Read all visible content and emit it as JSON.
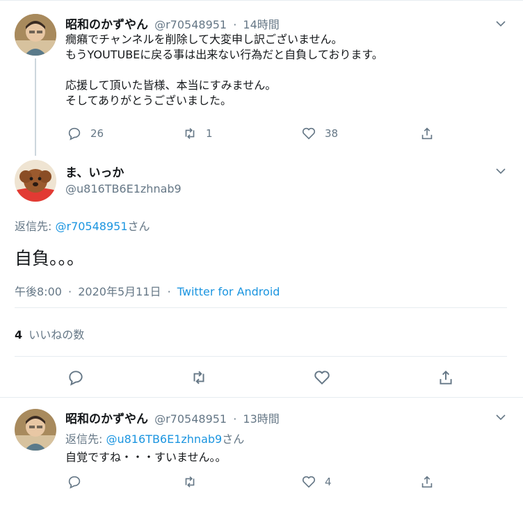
{
  "tweet1": {
    "name": "昭和のかずやん",
    "handle": "@r70548951",
    "sep": "·",
    "time": "14時間",
    "text": "癇癪でチャンネルを削除して大変申し訳ございません。\nもうYOUTUBEに戻る事は出来ない行為だと自負しております。\n\n応援して頂いた皆様、本当にすみません。\nそしてありがとうございました。",
    "replies": "26",
    "retweets": "1",
    "likes": "38"
  },
  "tweet2": {
    "name": "ま、いっか",
    "handle": "@u816TB6E1zhnab9",
    "reply_to_prefix": "返信先: ",
    "reply_to_handle": "@r70548951",
    "reply_to_suffix": "さん",
    "text": "自負。。。",
    "time": "午後8:00",
    "sep": "·",
    "date": "2020年5月11日",
    "client": "Twitter for Android",
    "likes_count": "4",
    "likes_label": "いいねの数"
  },
  "tweet3": {
    "name": "昭和のかずやん",
    "handle": "@r70548951",
    "sep": "·",
    "time": "13時間",
    "reply_to_prefix": "返信先: ",
    "reply_to_handle": "@u816TB6E1zhnab9",
    "reply_to_suffix": "さん",
    "text": "自覚ですね・・・すいません。。",
    "likes": "4"
  },
  "icons": {
    "reply": "reply-icon",
    "retweet": "retweet-icon",
    "like": "heart-icon",
    "share": "share-icon",
    "more": "chevron-down-icon"
  },
  "colors": {
    "link": "#1b95e0",
    "muted": "#657786",
    "text": "#14171a"
  }
}
